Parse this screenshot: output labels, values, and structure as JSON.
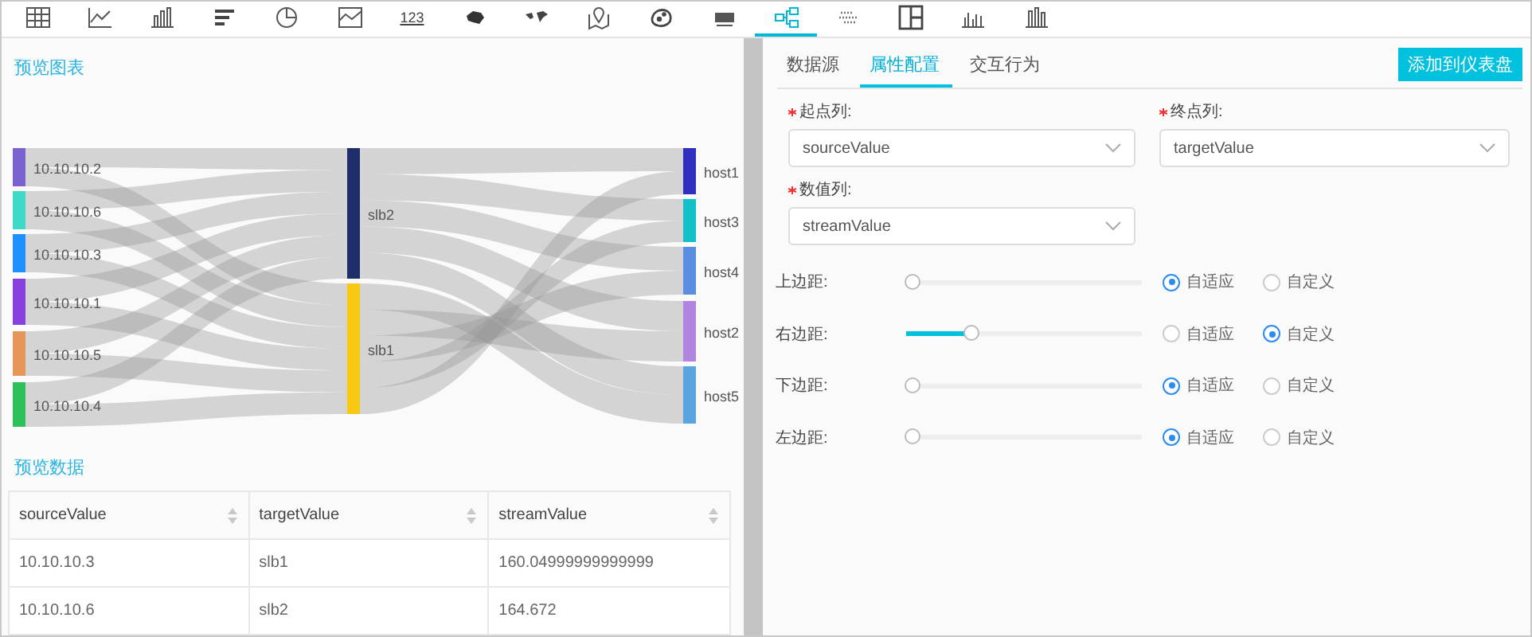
{
  "toolbar": [
    {
      "kind": "icon",
      "selected": false
    },
    {
      "kind": "icon",
      "selected": false
    },
    {
      "kind": "icon",
      "selected": false
    },
    {
      "kind": "icon",
      "selected": false
    },
    {
      "kind": "icon",
      "selected": false
    },
    {
      "kind": "icon",
      "selected": false
    },
    {
      "kind": "text",
      "label": "123",
      "selected": false
    },
    {
      "kind": "icon",
      "selected": false
    },
    {
      "kind": "icon",
      "selected": false
    },
    {
      "kind": "icon",
      "selected": false
    },
    {
      "kind": "icon",
      "selected": false
    },
    {
      "kind": "icon",
      "selected": false
    },
    {
      "kind": "icon",
      "selected": true
    },
    {
      "kind": "icon",
      "selected": false
    },
    {
      "kind": "icon",
      "selected": false
    },
    {
      "kind": "icon",
      "selected": false
    },
    {
      "kind": "icon",
      "selected": false
    }
  ],
  "preview_chart": {
    "title": "预览图表",
    "columns": [
      [
        {
          "label": "10.10.10.2",
          "color": "#7a62d0"
        },
        {
          "label": "10.10.10.6",
          "color": "#40d9c8"
        },
        {
          "label": "10.10.10.3",
          "color": "#1e90ff"
        },
        {
          "label": "10.10.10.1",
          "color": "#8a3fe0"
        },
        {
          "label": "10.10.10.5",
          "color": "#e8955a"
        },
        {
          "label": "10.10.10.4",
          "color": "#2ec05a"
        }
      ],
      [
        {
          "label": "slb2",
          "color": "#1f2d6b"
        },
        {
          "label": "slb1",
          "color": "#f9c812"
        }
      ],
      [
        {
          "label": "host1",
          "color": "#3030c0"
        },
        {
          "label": "host3",
          "color": "#14c0c8"
        },
        {
          "label": "host4",
          "color": "#5b8de0"
        },
        {
          "label": "host2",
          "color": "#b184e0"
        },
        {
          "label": "host5",
          "color": "#5aa5e0"
        }
      ]
    ]
  },
  "preview_data": {
    "title": "预览数据",
    "columns": [
      "sourceValue",
      "targetValue",
      "streamValue"
    ],
    "rows": [
      [
        "10.10.10.3",
        "slb1",
        "160.04999999999999"
      ],
      [
        "10.10.10.6",
        "slb2",
        "164.672"
      ]
    ]
  },
  "tabs": [
    {
      "label": "数据源",
      "selected": false
    },
    {
      "label": "属性配置",
      "selected": true
    },
    {
      "label": "交互行为",
      "selected": false
    }
  ],
  "add_button": "添加到仪表盘",
  "fields": [
    {
      "label": "起点列:",
      "required": true,
      "value": "sourceValue"
    },
    {
      "label": "终点列:",
      "required": true,
      "value": "targetValue"
    },
    {
      "label": "数值列:",
      "required": true,
      "value": "streamValue"
    }
  ],
  "margins": [
    {
      "label": "上边距:",
      "level": 0,
      "options": [
        {
          "label": "自适应",
          "selected": true
        },
        {
          "label": "自定义",
          "selected": false
        }
      ]
    },
    {
      "label": "右边距:",
      "level": 0.25,
      "options": [
        {
          "label": "自适应",
          "selected": false
        },
        {
          "label": "自定义",
          "selected": true
        }
      ]
    },
    {
      "label": "下边距:",
      "level": 0,
      "options": [
        {
          "label": "自适应",
          "selected": true
        },
        {
          "label": "自定义",
          "selected": false
        }
      ]
    },
    {
      "label": "左边距:",
      "level": 0,
      "options": [
        {
          "label": "自适应",
          "selected": true
        },
        {
          "label": "自定义",
          "selected": false
        }
      ]
    }
  ]
}
